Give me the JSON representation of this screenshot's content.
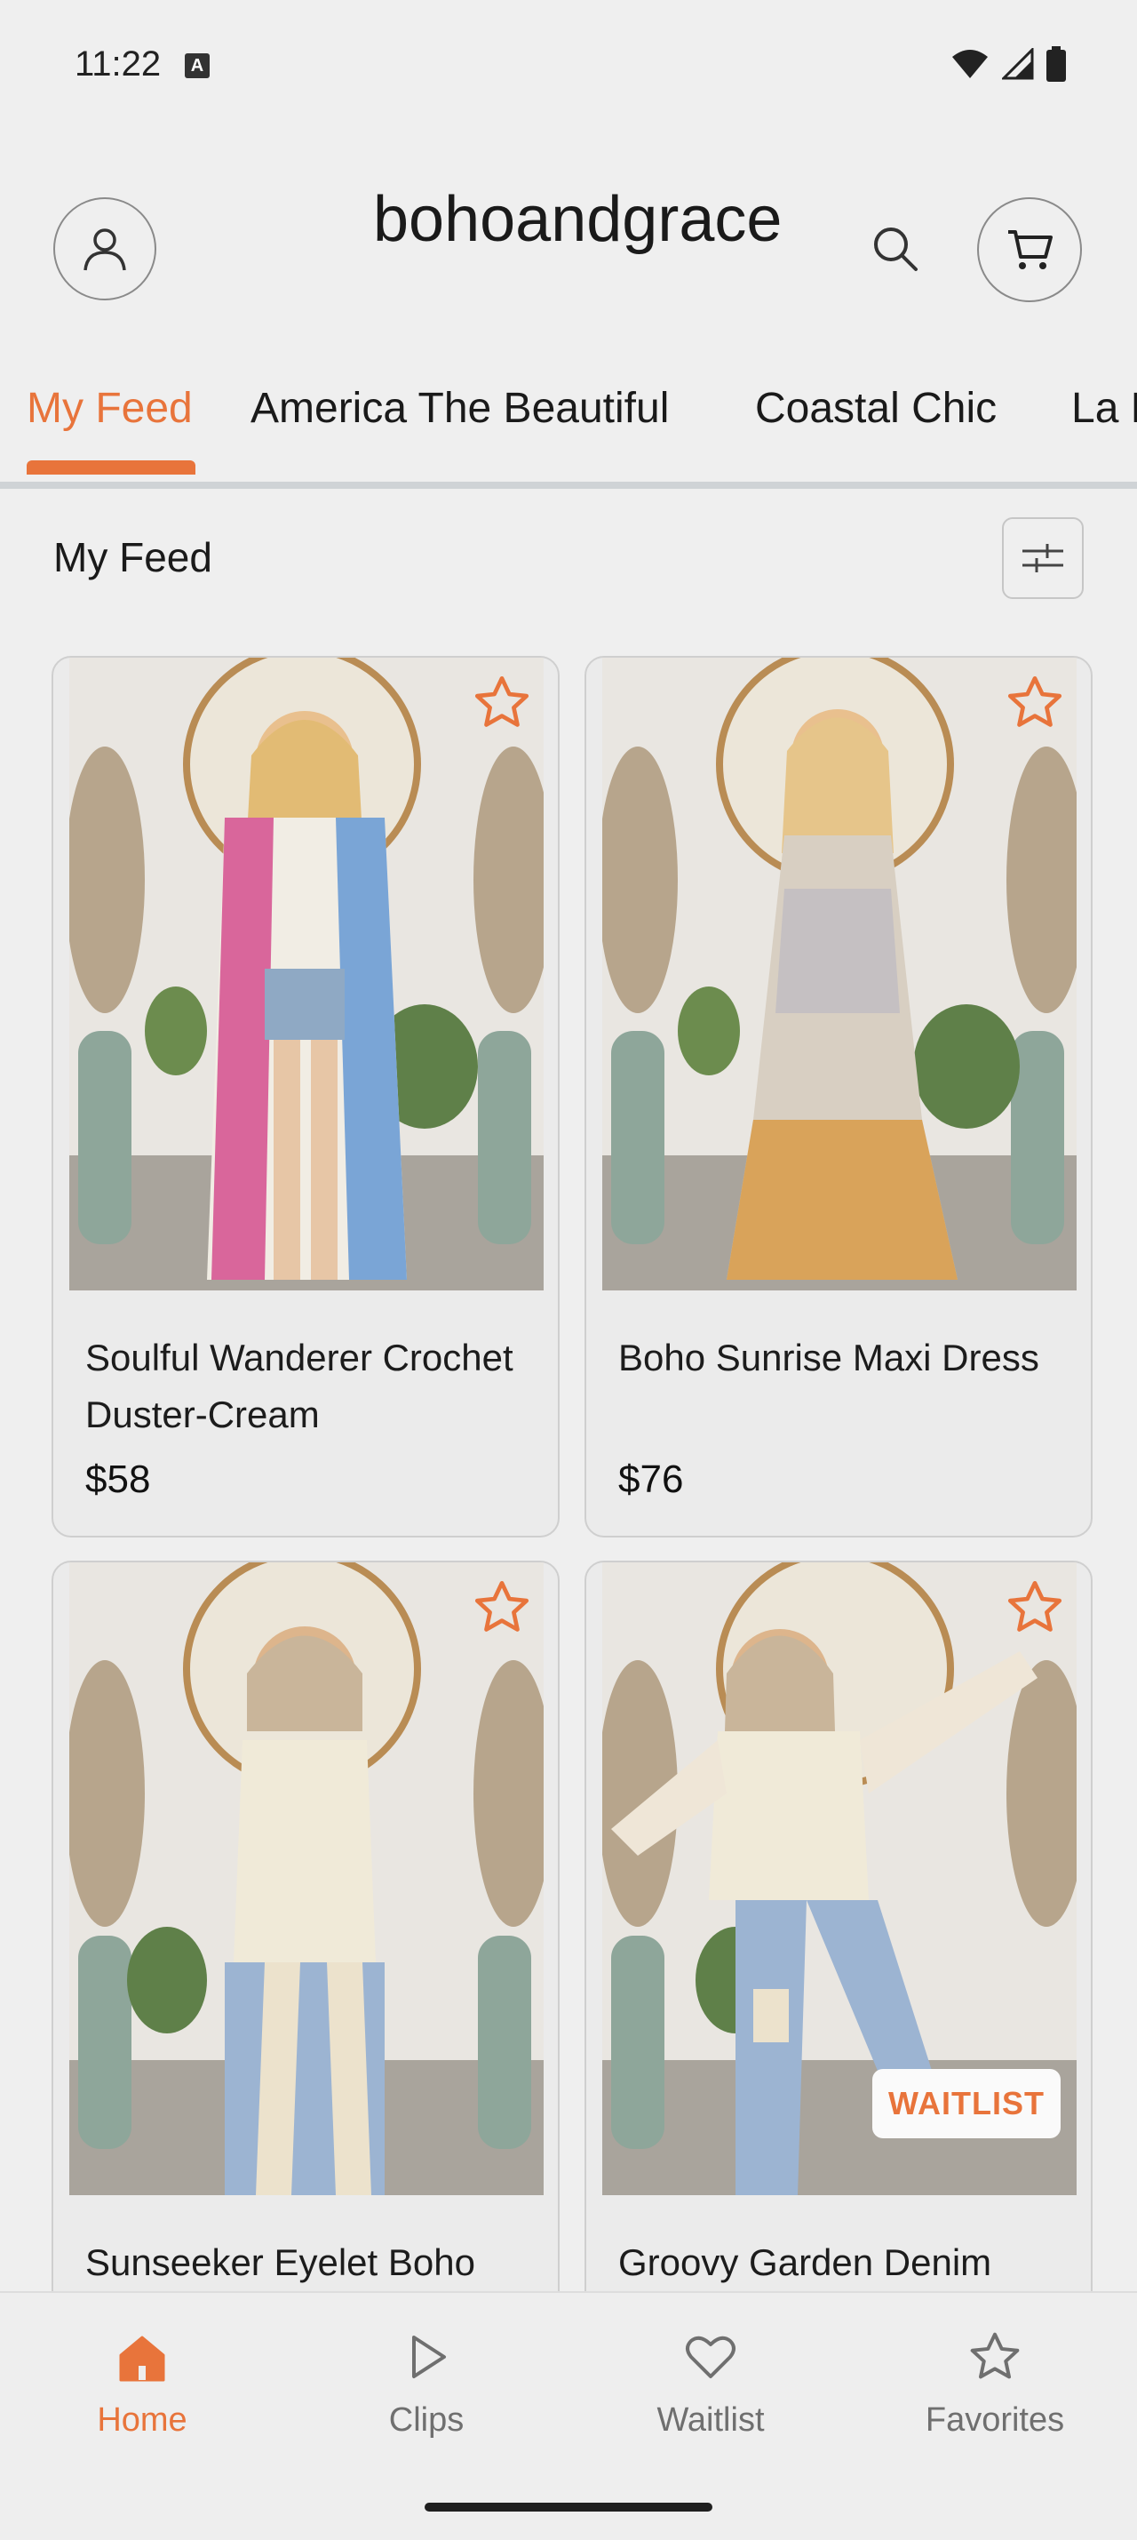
{
  "status_bar": {
    "time": "11:22",
    "notification_glyph": "A"
  },
  "header": {
    "store_name": "bohoandgrace"
  },
  "tabs": [
    {
      "label": "My Feed",
      "active": true
    },
    {
      "label": "America The Beautiful",
      "active": false
    },
    {
      "label": "Coastal Chic",
      "active": false
    },
    {
      "label": "La F",
      "active": false
    }
  ],
  "feed": {
    "title": "My Feed"
  },
  "products": [
    {
      "name": "Soulful Wanderer Crochet Duster-Cream",
      "price": "$58",
      "badge": "",
      "favorite_icon": "star-outline-icon"
    },
    {
      "name": "Boho Sunrise Maxi Dress",
      "price": "$76",
      "badge": "",
      "favorite_icon": "star-outline-icon"
    },
    {
      "name": "Sunseeker Eyelet Boho",
      "price": "",
      "badge": "",
      "favorite_icon": "star-outline-icon"
    },
    {
      "name": "Groovy Garden Denim",
      "price": "",
      "badge": "WAITLIST",
      "favorite_icon": "star-outline-icon"
    }
  ],
  "bottom_nav": [
    {
      "label": "Home",
      "icon": "home-icon",
      "active": true
    },
    {
      "label": "Clips",
      "icon": "play-icon",
      "active": false
    },
    {
      "label": "Waitlist",
      "icon": "heart-icon",
      "active": false
    },
    {
      "label": "Favorites",
      "icon": "star-icon",
      "active": false
    }
  ],
  "colors": {
    "accent": "#e8743b",
    "background": "#efefef",
    "text": "#1f1f1f"
  }
}
